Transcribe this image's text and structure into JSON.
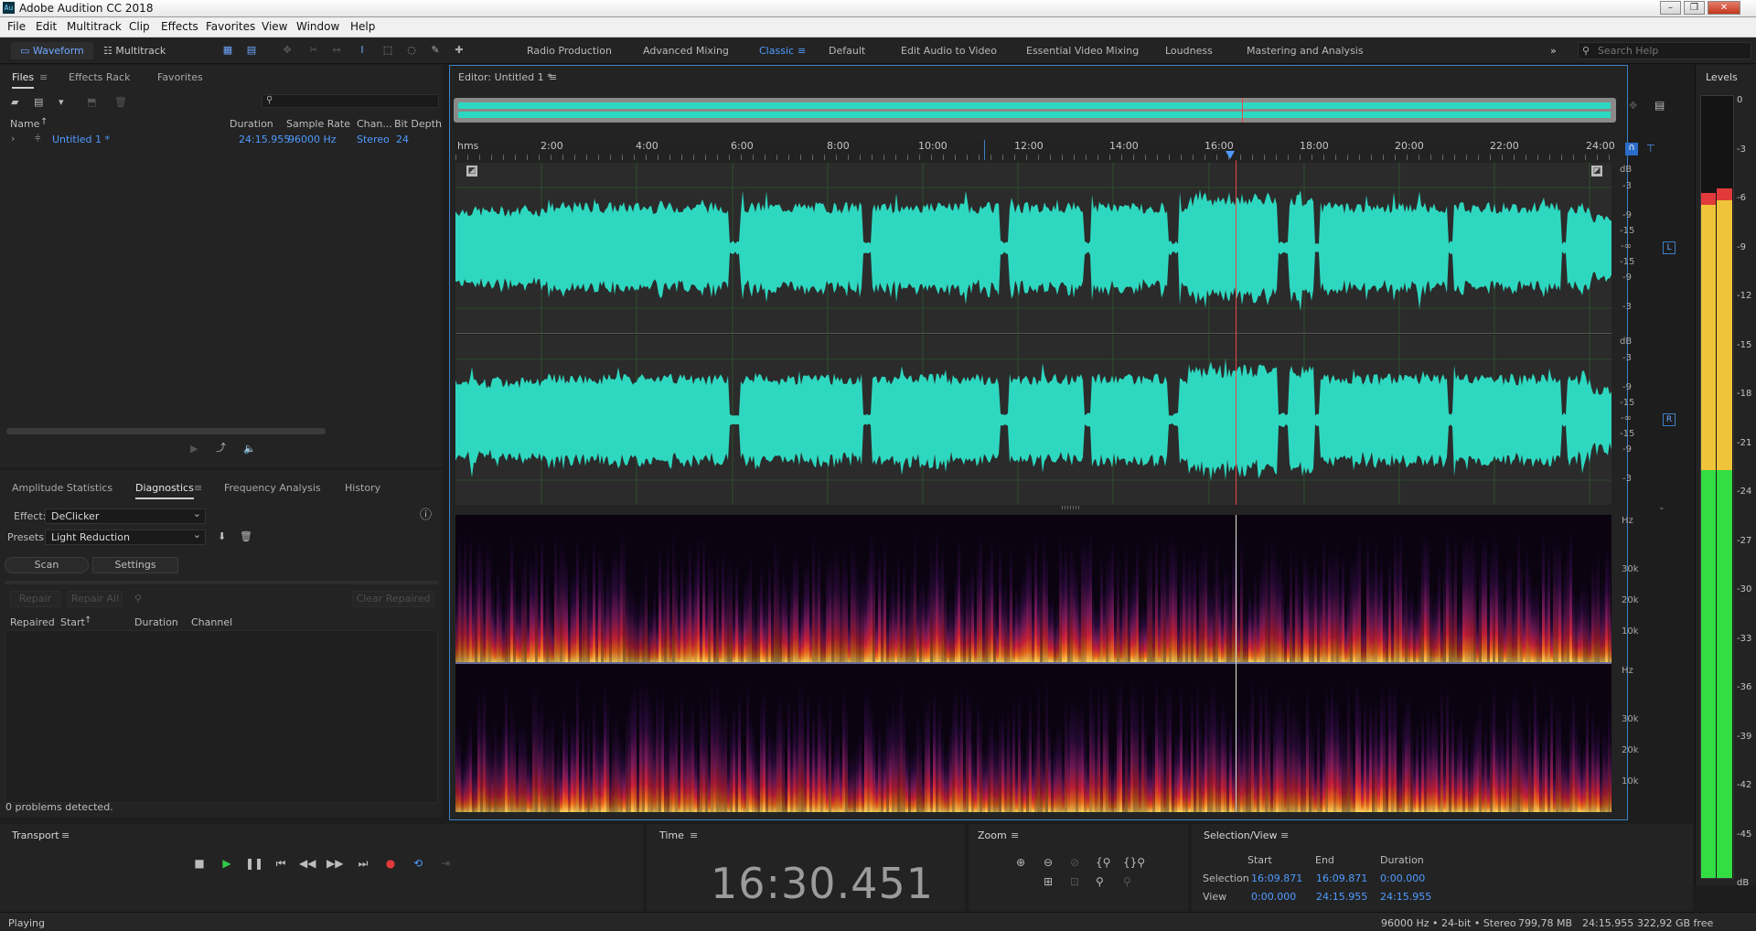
{
  "app": {
    "title": "Adobe Audition CC 2018",
    "icon": "Au"
  },
  "menu": [
    "File",
    "Edit",
    "Multitrack",
    "Clip",
    "Effects",
    "Favorites",
    "View",
    "Window",
    "Help"
  ],
  "toolbar": {
    "waveform": "Waveform",
    "multitrack": "Multitrack",
    "workspaces": [
      {
        "label": "Radio Production",
        "active": false
      },
      {
        "label": "Advanced Mixing",
        "active": false
      },
      {
        "label": "Classic",
        "active": true
      },
      {
        "label": "Default",
        "active": false
      },
      {
        "label": "Edit Audio to Video",
        "active": false
      },
      {
        "label": "Essential Video Mixing",
        "active": false
      },
      {
        "label": "Loudness",
        "active": false
      },
      {
        "label": "Mastering and Analysis",
        "active": false
      }
    ],
    "search_placeholder": "Search Help"
  },
  "files_panel": {
    "tabs": [
      "Files",
      "Effects Rack",
      "Favorites"
    ],
    "columns": {
      "name": "Name",
      "duration": "Duration",
      "sample_rate": "Sample Rate",
      "channels": "Chan...",
      "bit_depth": "Bit Depth"
    },
    "rows": [
      {
        "name": "Untitled 1 *",
        "duration": "24:15.955",
        "sample_rate": "96000 Hz",
        "channels": "Stereo",
        "bit_depth": "24"
      }
    ]
  },
  "diag_panel": {
    "tabs": [
      "Amplitude Statistics",
      "Diagnostics",
      "Frequency Analysis",
      "History"
    ],
    "effect_label": "Effect:",
    "effect_value": "DeClicker",
    "presets_label": "Presets:",
    "presets_value": "Light Reduction",
    "scan": "Scan",
    "settings": "Settings",
    "repair": "Repair",
    "repair_all": "Repair All",
    "clear_repaired": "Clear Repaired",
    "columns": {
      "repaired": "Repaired",
      "start": "Start",
      "duration": "Duration",
      "channel": "Channel"
    },
    "status": "0 problems detected."
  },
  "editor": {
    "title": "Editor: Untitled 1 *",
    "ruler": [
      "hms",
      "2:00",
      "4:00",
      "6:00",
      "8:00",
      "10:00",
      "12:00",
      "14:00",
      "16:00",
      "18:00",
      "20:00",
      "22:00",
      "24:00"
    ],
    "db_labels": [
      "dB",
      "-3",
      "-9",
      "-15",
      "-∞",
      "-15",
      "-9",
      "-3"
    ],
    "channels": {
      "left": "L",
      "right": "R"
    },
    "hz_labels": [
      "Hz",
      "30k",
      "20k",
      "10k"
    ],
    "playhead_fraction": 0.675
  },
  "levels": {
    "title": "Levels",
    "scale": [
      "0",
      "-3",
      "-6",
      "-9",
      "-12",
      "-15",
      "-18",
      "-21",
      "-24",
      "-27",
      "-30",
      "-33",
      "-36",
      "-39",
      "-42",
      "-45",
      "dB"
    ]
  },
  "transport": {
    "title": "Transport"
  },
  "time": {
    "title": "Time",
    "value": "16:30.451"
  },
  "zoom": {
    "title": "Zoom"
  },
  "selection": {
    "title": "Selection/View",
    "cols": [
      "Start",
      "End",
      "Duration"
    ],
    "rows": [
      {
        "label": "Selection",
        "start": "16:09.871",
        "end": "16:09.871",
        "duration": "0:00.000"
      },
      {
        "label": "View",
        "start": "0:00.000",
        "end": "24:15.955",
        "duration": "24:15.955"
      }
    ]
  },
  "status": {
    "state": "Playing",
    "format": "96000 Hz • 24-bit • Stereo",
    "size": "799,78 MB",
    "duration": "24:15.955",
    "free": "322,92 GB free"
  },
  "colors": {
    "wave": "#2ed8c0",
    "accent": "#4f9bff",
    "playhead": "#e8474a"
  }
}
